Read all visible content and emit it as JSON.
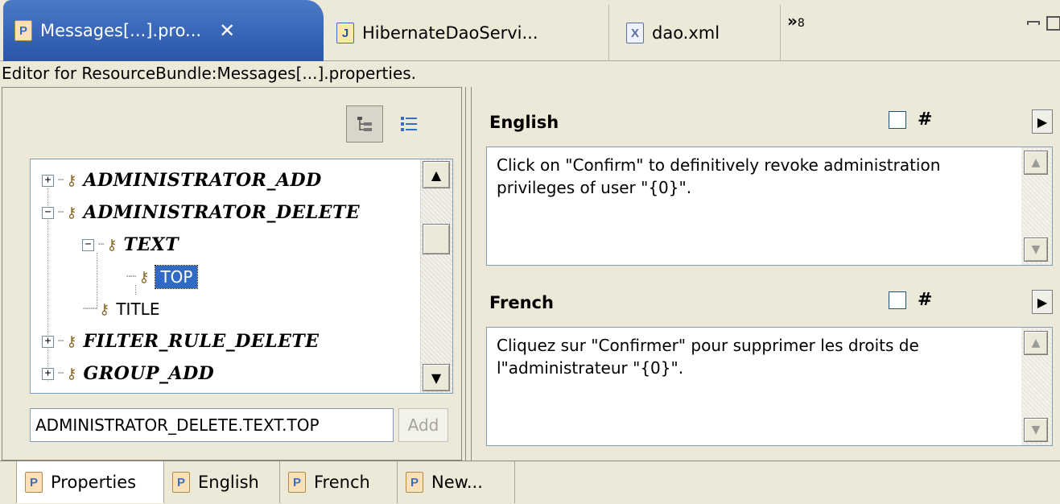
{
  "editor_tabs": [
    {
      "label": "Messages[...].pro...",
      "icon": "properties-file-icon",
      "active": true
    },
    {
      "label": "HibernateDaoServi...",
      "icon": "java-file-icon",
      "active": false
    },
    {
      "label": "dao.xml",
      "icon": "xml-file-icon",
      "active": false
    }
  ],
  "tab_close": "✕",
  "overflow": {
    "glyph": "»",
    "count": "8"
  },
  "description": "Editor for ResourceBundle:Messages[...].properties.",
  "tree": {
    "items": [
      {
        "label": "ADMINISTRATOR_ADD",
        "expander": "+"
      },
      {
        "label": "ADMINISTRATOR_DELETE",
        "expander": "−"
      },
      {
        "label": "TEXT",
        "expander": "−"
      },
      {
        "label": "TOP"
      },
      {
        "label": "TITLE"
      },
      {
        "label": "FILTER_RULE_DELETE",
        "expander": "+"
      },
      {
        "label": "GROUP_ADD",
        "expander": "+"
      }
    ]
  },
  "key_input": {
    "value": "ADMINISTRATOR_DELETE.TEXT.TOP"
  },
  "add_button": {
    "label": "Add"
  },
  "locales": [
    {
      "title": "English",
      "hash": "#",
      "text": "Click on \"Confirm\" to definitively revoke administration privileges of user \"{0}\"."
    },
    {
      "title": "French",
      "hash": "#",
      "text": "Cliquez sur \"Confirmer\" pour supprimer les droits de l\"administrateur \"{0}\"."
    }
  ],
  "bottom_tabs": [
    {
      "label": "Properties",
      "icon": "properties-icon",
      "active": true
    },
    {
      "label": "English",
      "icon": "properties-file-icon",
      "active": false
    },
    {
      "label": "French",
      "icon": "properties-file-icon",
      "active": false
    },
    {
      "label": "New...",
      "icon": "new-properties-icon",
      "active": false
    }
  ],
  "colors": {
    "active_tab": "#2a55a8",
    "selection": "#316ac5",
    "background": "#ece9d8"
  }
}
